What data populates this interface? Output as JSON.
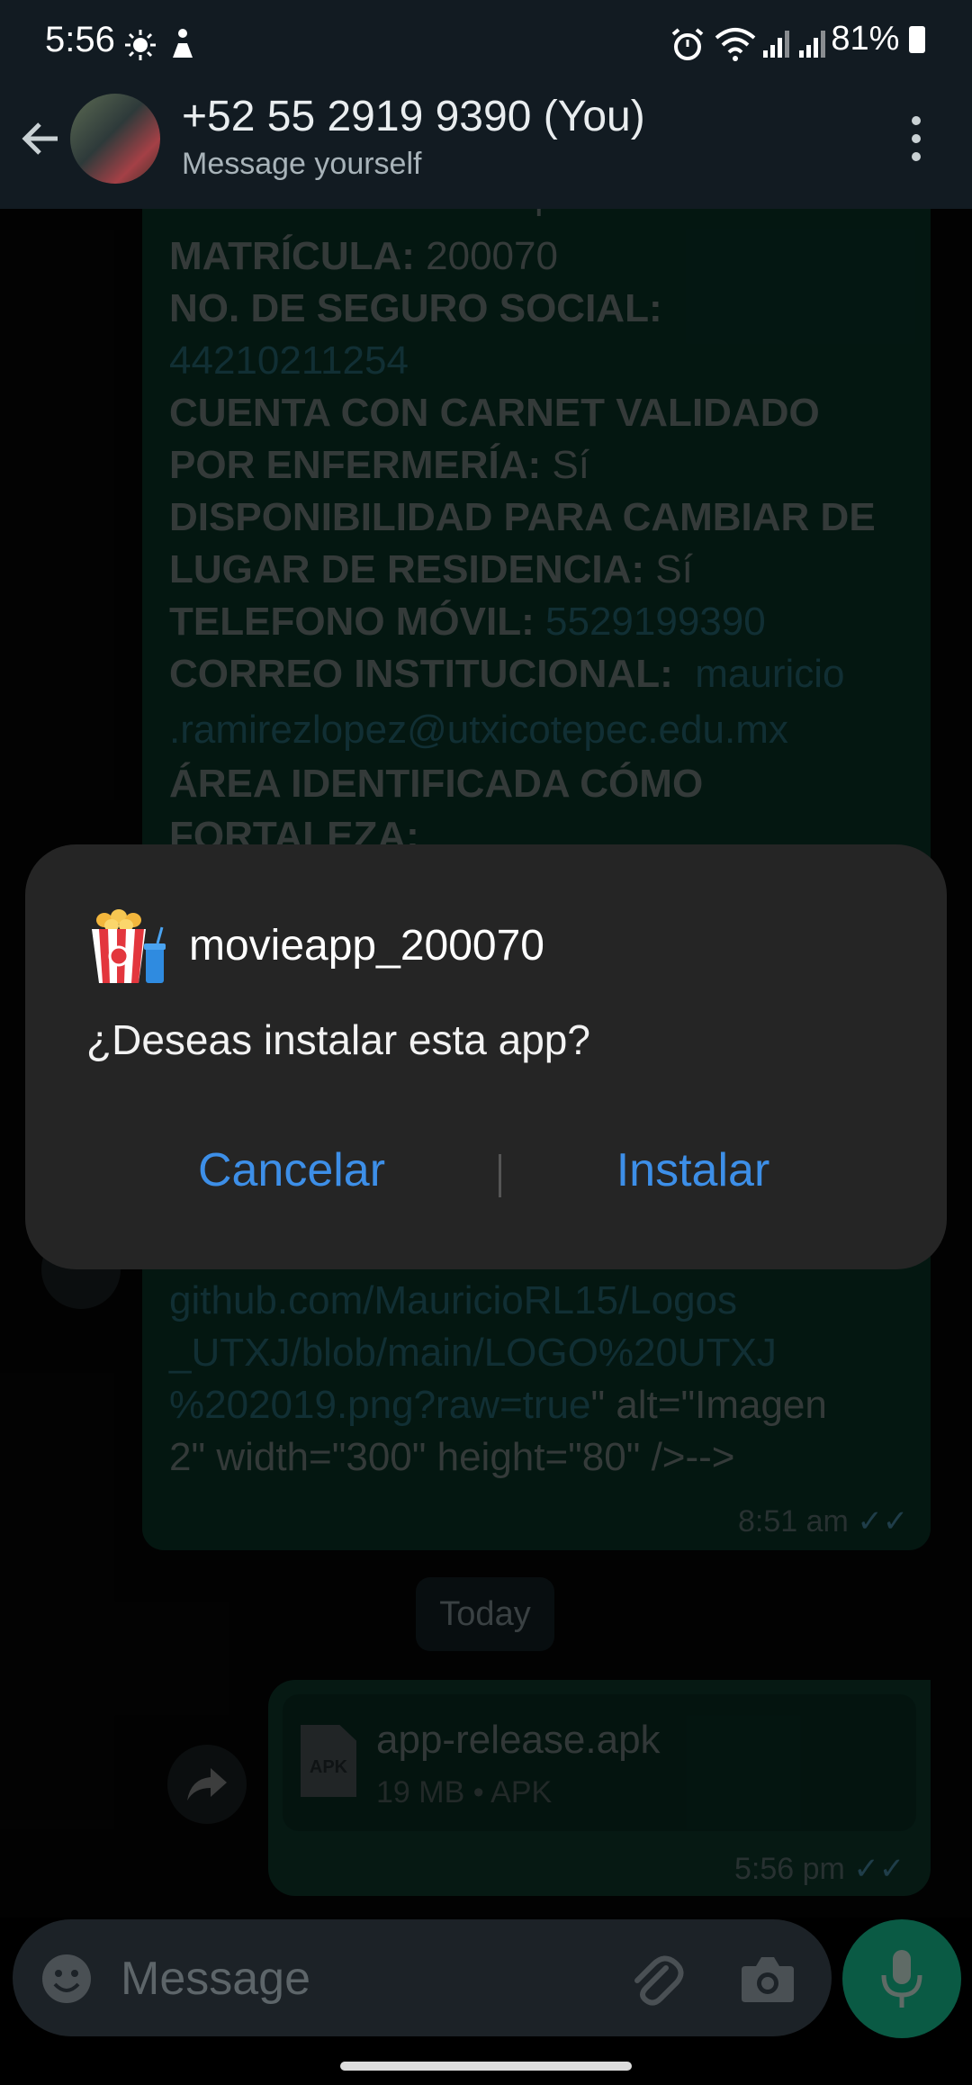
{
  "status_bar": {
    "time": "5:56",
    "battery": "81%"
  },
  "header": {
    "title": "+52 55 2919 9390 (You)",
    "subtitle": "Message yourself"
  },
  "message": {
    "partial_name": "Mauricio Ramírez López",
    "matricula_label": "MATRÍCULA:",
    "matricula_value": "200070",
    "nss_label": "NO. DE SEGURO SOCIAL:",
    "nss_value": "44210211254",
    "carnet_label_1": "CUENTA CON CARNET VALIDADO",
    "carnet_label_2": "POR ENFERMERÍA:",
    "carnet_value": "Sí",
    "disp_label_1": "DISPONIBILIDAD PARA CAMBIAR DE",
    "disp_label_2": "LUGAR DE RESIDENCIA:",
    "disp_value": "Sí",
    "tel_label": "TELEFONO MÓVIL:",
    "tel_value": "5529199390",
    "correo_label": "CORREO INSTITUCIONAL:",
    "correo_value_1": "mauricio",
    "correo_value_2": ".ramirezlopez@utxicotepec.edu.mx",
    "area_label_1": "ÁREA IDENTIFICADA CÓMO",
    "area_label_2": "FORTALEZA:",
    "link_1": "github.com/MauricioRL15/Logos",
    "link_2": "_UTXJ/blob/main/LOGO%20UTXJ",
    "link_3": "%202019.png?raw=true",
    "after_link_3": "\" alt=\"Imagen",
    "line_last": "2\" width=\"300\" height=\"80\" />-->",
    "time": "8:51 am"
  },
  "date_chip": "Today",
  "file_message": {
    "filename": "app-release.apk",
    "meta": "19 MB • APK",
    "file_icon_label": "APK",
    "time": "5:56 pm"
  },
  "dialog": {
    "app_name": "movieapp_200070",
    "question": "¿Deseas instalar esta app?",
    "cancel_label": "Cancelar",
    "install_label": "Instalar"
  },
  "composer": {
    "placeholder": "Message"
  },
  "colors": {
    "accent": "#3d8fe8",
    "bubble": "#0b2e24",
    "mic": "#0a5a44"
  }
}
